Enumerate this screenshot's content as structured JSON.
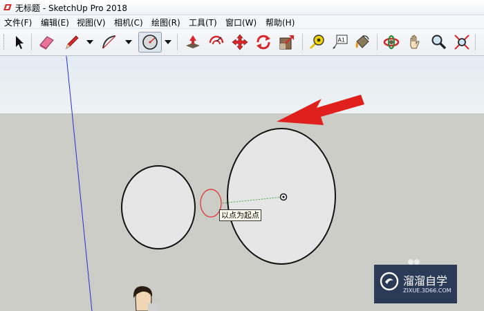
{
  "window": {
    "title": "无标题 - SketchUp Pro 2018",
    "icon": "sketchup-logo-icon"
  },
  "menu": [
    "文件(F)",
    "编辑(E)",
    "视图(V)",
    "相机(C)",
    "绘图(R)",
    "工具(T)",
    "窗口(W)",
    "帮助(H)"
  ],
  "toolbar": {
    "tools": [
      {
        "name": "select-tool",
        "icon": "arrow-cursor-icon"
      },
      {
        "name": "eraser-tool",
        "icon": "eraser-icon"
      },
      {
        "name": "line-tool",
        "icon": "pencil-icon"
      },
      {
        "name": "arc-tool",
        "icon": "arc-icon"
      },
      {
        "name": "circle-tool",
        "icon": "circle-icon",
        "active": true
      },
      {
        "name": "push-pull-tool",
        "icon": "push-pull-icon"
      },
      {
        "name": "offset-tool",
        "icon": "offset-icon"
      },
      {
        "name": "move-tool",
        "icon": "move-arrows-icon"
      },
      {
        "name": "rotate-tool",
        "icon": "rotate-icon"
      },
      {
        "name": "scale-tool",
        "icon": "scale-icon"
      },
      {
        "name": "tape-measure-tool",
        "icon": "tape-measure-icon"
      },
      {
        "name": "text-tool",
        "icon": "text-label-icon",
        "label": "A1"
      },
      {
        "name": "paint-bucket-tool",
        "icon": "paint-bucket-icon"
      },
      {
        "name": "orbit-tool",
        "icon": "orbit-icon"
      },
      {
        "name": "pan-tool",
        "icon": "hand-icon"
      },
      {
        "name": "zoom-tool",
        "icon": "magnifier-icon"
      },
      {
        "name": "zoom-extents-tool",
        "icon": "zoom-extents-icon"
      }
    ]
  },
  "viewport": {
    "colors": {
      "sky": "#e6eef2",
      "ground": "#cdcdc7",
      "face": "#e6e6e6",
      "edge": "#111111",
      "arrow": "#e0201c",
      "axis": "#2a2adc"
    },
    "tooltip": "以点为起点"
  },
  "watermark": {
    "name": "溜溜自学",
    "site": "ZIXUE.3D66.COM"
  }
}
